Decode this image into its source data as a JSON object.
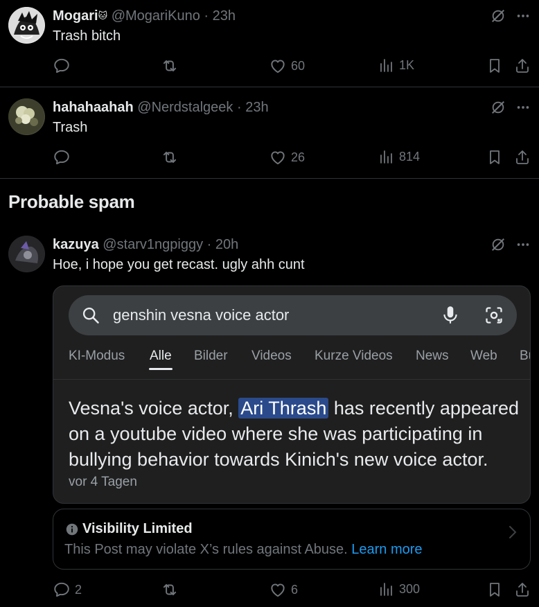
{
  "posts": [
    {
      "name": "Mogari🐱",
      "name_text": "Mogari",
      "handle": "@MogariKuno",
      "time": "23h",
      "text": "Trash bitch",
      "likes": "60",
      "views": "1K"
    },
    {
      "name_text": "hahahaahah",
      "handle": "@Nerdstalgeek",
      "time": "23h",
      "text": "Trash",
      "likes": "26",
      "views": "814"
    },
    {
      "name_text": "kazuya",
      "handle": "@starv1ngpiggy",
      "time": "20h",
      "text": "Hoe, i hope you get recast. ugly ahh cunt",
      "replies": "2",
      "likes": "6",
      "views": "300"
    }
  ],
  "section_title": "Probable spam",
  "separator": "·",
  "media": {
    "search_query": "genshin vesna voice actor",
    "tabs": [
      "KI-Modus",
      "Alle",
      "Bilder",
      "Videos",
      "Kurze Videos",
      "News",
      "Web",
      "Bü"
    ],
    "active_tab": "Alle",
    "snippet_before": "Vesna's voice actor, ",
    "snippet_highlight": "Ari Thrash",
    "snippet_after": " has recently appeared on a youtube video where she was participating in bullying behavior towards Kinich's new voice actor.",
    "date": "vor 4 Tagen"
  },
  "notice": {
    "title": "Visibility Limited",
    "text": "This Post may violate X’s rules against Abuse. ",
    "link": "Learn more"
  },
  "colors": {
    "background": "#000000",
    "text": "#e7e9ea",
    "muted": "#71767b",
    "link": "#1d9bf0",
    "highlight": "#2a4a8c"
  },
  "icons": [
    "reply-icon",
    "repost-icon",
    "like-icon",
    "views-icon",
    "bookmark-icon",
    "share-icon",
    "grok-icon",
    "more-icon",
    "search-icon",
    "mic-icon",
    "lens-icon",
    "info-icon",
    "chevron-right-icon"
  ]
}
